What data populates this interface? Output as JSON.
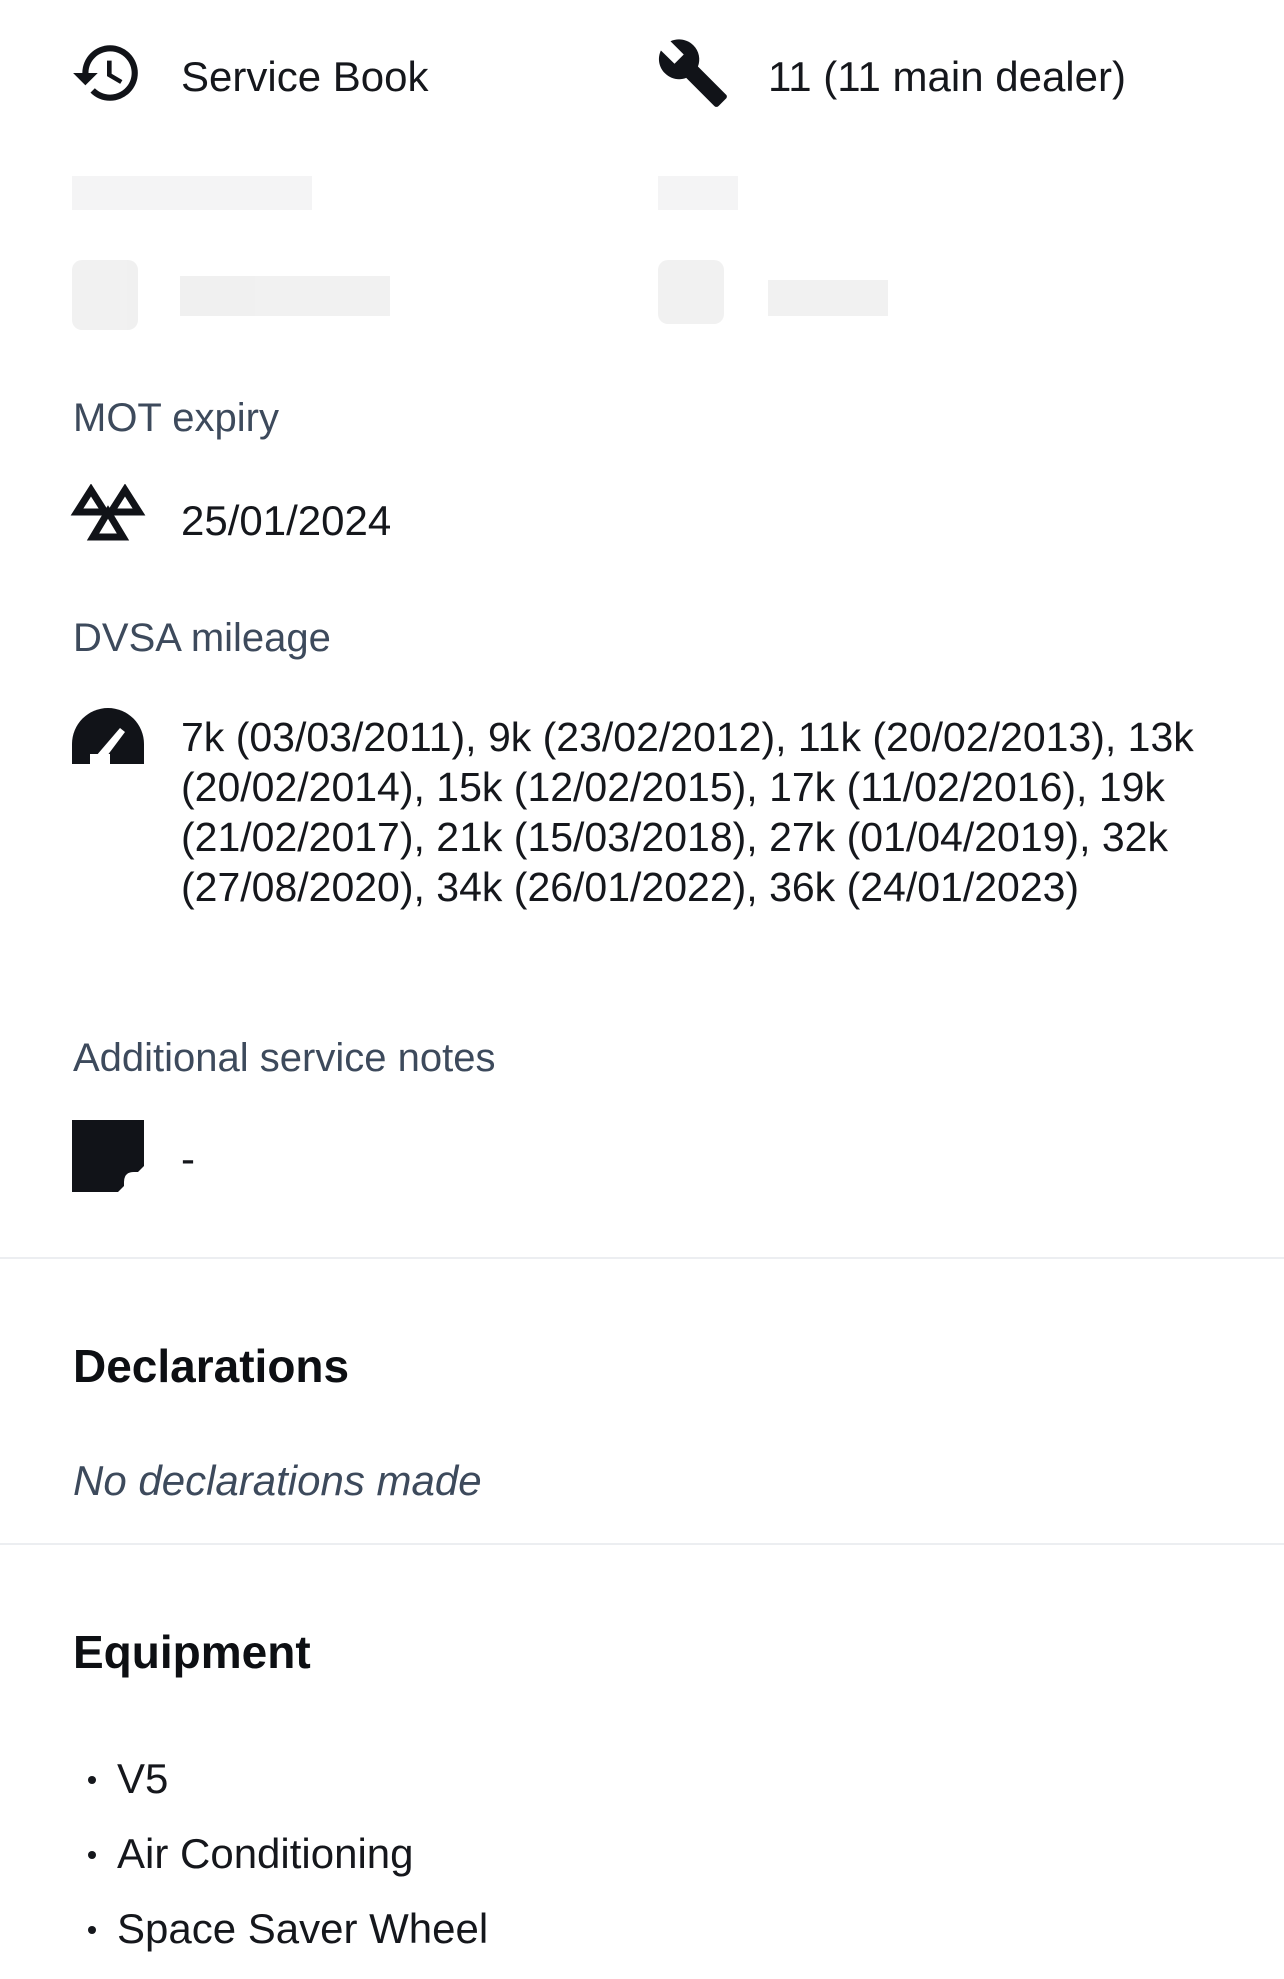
{
  "service_history": {
    "icon": "history-icon",
    "value": "Service Book"
  },
  "services": {
    "icon": "wrench-icon",
    "value": "11 (11 main dealer)"
  },
  "mot": {
    "label": "MOT expiry",
    "icon": "mot-triangles-icon",
    "value": "25/01/2024"
  },
  "dvsa": {
    "label": "DVSA mileage",
    "icon": "speedometer-icon",
    "value": "7k (03/03/2011), 9k (23/02/2012), 11k (20/02/2013), 13k (20/02/2014), 15k (12/02/2015), 17k (11/02/2016), 19k (21/02/2017), 21k (15/03/2018), 27k (01/04/2019), 32k (27/08/2020), 34k (26/01/2022), 36k (24/01/2023)"
  },
  "notes": {
    "label": "Additional service notes",
    "icon": "sticky-note-icon",
    "value": "-"
  },
  "declarations": {
    "title": "Declarations",
    "text": "No declarations made"
  },
  "equipment": {
    "title": "Equipment",
    "items": [
      "V5",
      "Air Conditioning",
      "Space Saver Wheel"
    ]
  }
}
